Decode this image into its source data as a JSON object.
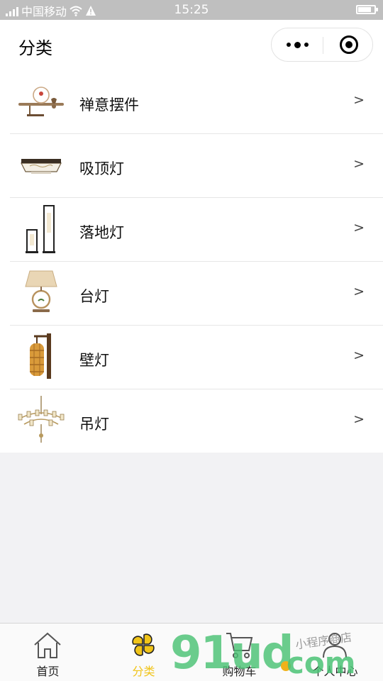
{
  "status_bar": {
    "carrier": "中国移动",
    "time": "15:25"
  },
  "nav": {
    "title": "分类"
  },
  "categories": [
    {
      "label": "禅意摆件",
      "arrow": ">",
      "icon": "zen-ornament-thumbnail"
    },
    {
      "label": "吸顶灯",
      "arrow": ">",
      "icon": "ceiling-light-thumbnail"
    },
    {
      "label": "落地灯",
      "arrow": ">",
      "icon": "floor-lamp-thumbnail"
    },
    {
      "label": "台灯",
      "arrow": ">",
      "icon": "table-lamp-thumbnail"
    },
    {
      "label": "壁灯",
      "arrow": ">",
      "icon": "wall-lamp-thumbnail"
    },
    {
      "label": "吊灯",
      "arrow": ">",
      "icon": "chandelier-thumbnail"
    }
  ],
  "tabbar": {
    "active_color": "#f0c419",
    "items": [
      {
        "label": "首页",
        "icon": "home-icon"
      },
      {
        "label": "分类",
        "icon": "category-icon",
        "active": true
      },
      {
        "label": "购物车",
        "icon": "cart-icon"
      },
      {
        "label": "个人中心",
        "icon": "user-icon"
      }
    ]
  },
  "watermark": {
    "main": "91ud",
    "suffix": "com",
    "handwriting": "小程序商店"
  }
}
